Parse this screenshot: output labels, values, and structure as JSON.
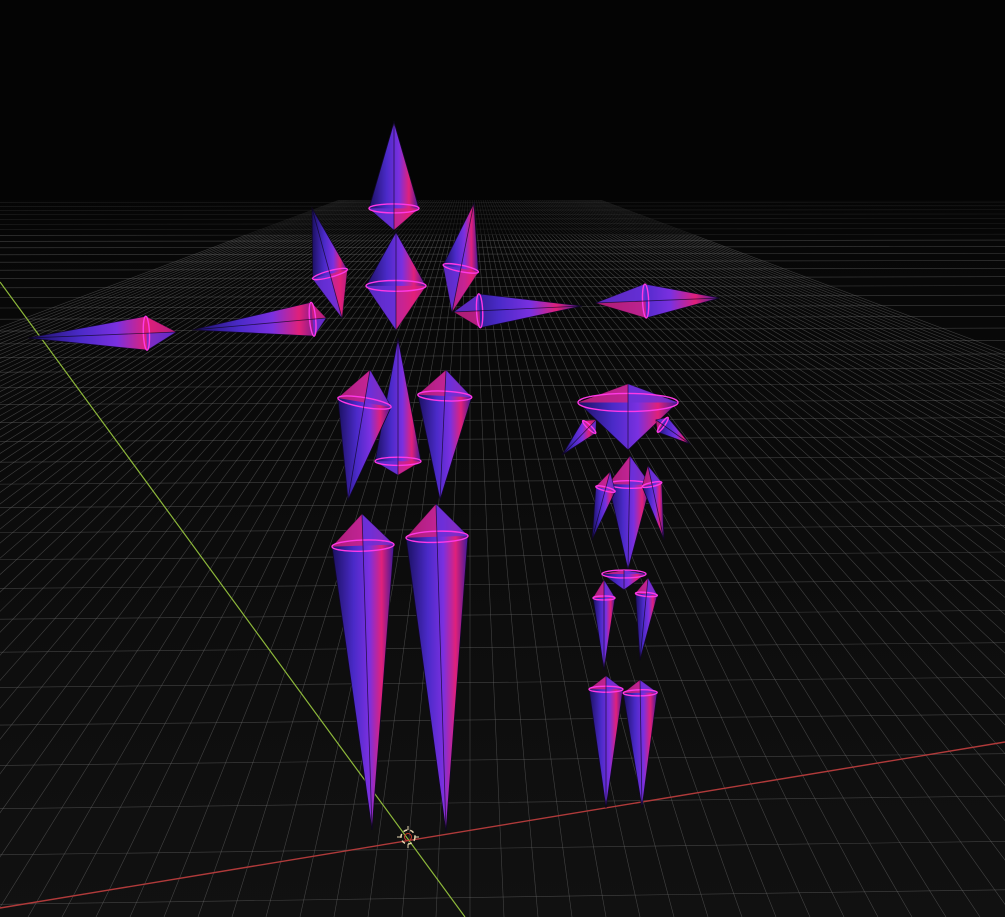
{
  "viewport": {
    "name": "3d-viewport",
    "colors": {
      "background": "#050505",
      "grid_line": "#6e6e6e",
      "axis_x": "#b03a3a",
      "axis_y": "#8db83a",
      "bone_dark": "#2a1a8a",
      "bone_mid": "#6a2fd6",
      "bone_accent": "#e0207a",
      "bone_edge": "#ff38e6",
      "cursor_outer": "#e8d7b0",
      "cursor_inner": "#c23b2d"
    },
    "objects": [
      {
        "name": "armature-large",
        "type": "armature",
        "bone_count": 16
      },
      {
        "name": "armature-small",
        "type": "armature",
        "bone_count": 11
      }
    ],
    "cursor": {
      "name": "3d-cursor-icon"
    }
  }
}
